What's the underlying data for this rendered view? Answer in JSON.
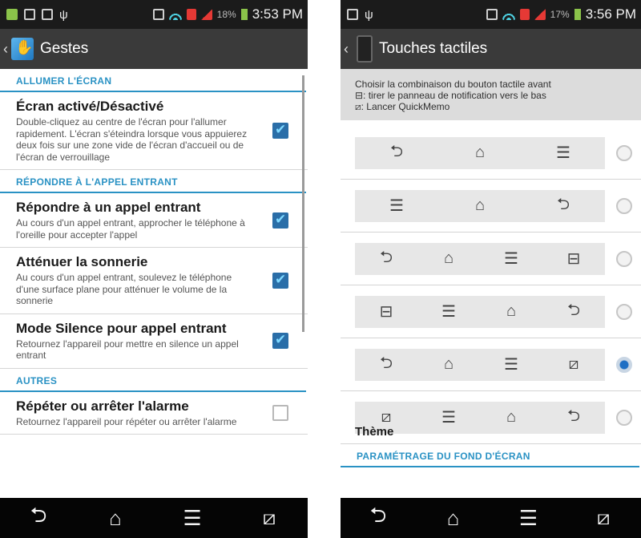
{
  "left": {
    "status": {
      "percent": "18%",
      "time": "3:53 PM"
    },
    "title": "Gestes",
    "sections": [
      {
        "header": "ALLUMER L'ÉCRAN",
        "items": [
          {
            "title": "Écran activé/Désactivé",
            "desc": "Double-cliquez au centre de l'écran pour l'allumer rapidement. L'écran s'éteindra lorsque vous appuierez deux fois sur une zone vide de l'écran d'accueil ou de l'écran de verrouillage",
            "checked": true
          }
        ]
      },
      {
        "header": "RÉPONDRE À L'APPEL ENTRANT",
        "items": [
          {
            "title": "Répondre à un appel entrant",
            "desc": "Au cours d'un appel entrant, approcher le téléphone à l'oreille pour accepter l'appel",
            "checked": true
          },
          {
            "title": "Atténuer la sonnerie",
            "desc": "Au cours d'un appel entrant, soulevez le téléphone d'une surface plane pour atténuer le volume de la sonnerie",
            "checked": true
          },
          {
            "title": "Mode Silence pour appel entrant",
            "desc": "Retournez l'appareil pour mettre en silence un appel entrant",
            "checked": true
          }
        ]
      },
      {
        "header": "AUTRES",
        "items": [
          {
            "title": "Répéter ou arrêter l'alarme",
            "desc": "Retournez l'appareil pour répéter ou arrêter l'alarme",
            "checked": false
          }
        ]
      }
    ]
  },
  "right": {
    "status": {
      "percent": "17%",
      "time": "3:56 PM"
    },
    "title": "Touches tactiles",
    "info": [
      "Choisir la combinaison du bouton tactile avant",
      "⊟: tirer le panneau de notification vers le bas",
      "⧄: Lancer QuickMemo"
    ],
    "combinations": [
      {
        "icons": [
          "back-icon",
          "home-icon",
          "menu-icon"
        ],
        "selected": false
      },
      {
        "icons": [
          "menu-icon",
          "home-icon",
          "back-icon"
        ],
        "selected": false
      },
      {
        "icons": [
          "back-icon",
          "home-icon",
          "menu-icon",
          "notification-icon"
        ],
        "selected": false
      },
      {
        "icons": [
          "notification-icon",
          "menu-icon",
          "home-icon",
          "back-icon"
        ],
        "selected": false
      },
      {
        "icons": [
          "back-icon",
          "home-icon",
          "menu-icon",
          "quickmemo-icon"
        ],
        "selected": true
      },
      {
        "icons": [
          "quickmemo-icon",
          "menu-icon",
          "home-icon",
          "back-icon"
        ],
        "selected": false
      }
    ],
    "wallpaper_header": "PARAMÉTRAGE DU FOND D'ÉCRAN",
    "theme_label": "Thème"
  },
  "navbar": [
    "back-icon",
    "home-icon",
    "menu-icon",
    "quickmemo-icon"
  ],
  "colors": {
    "accent": "#2a92c4",
    "titlebar": "#3a3a3a",
    "statusbar": "#1b1b1b",
    "navbar": "#050505"
  }
}
